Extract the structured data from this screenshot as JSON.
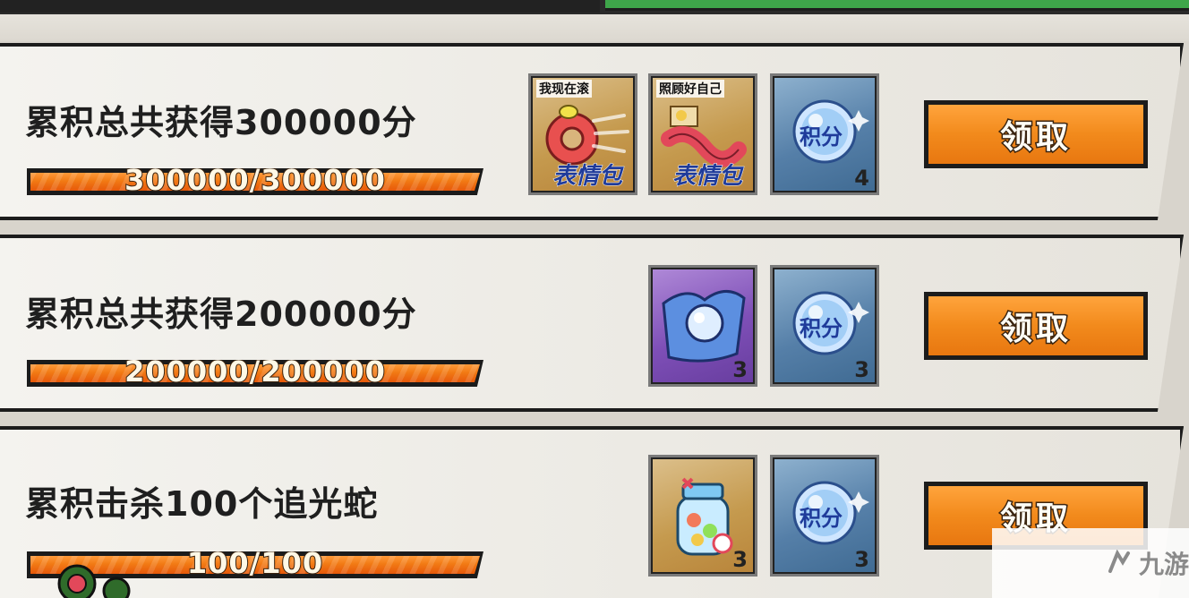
{
  "colors": {
    "accent_orange": "#f28a1c",
    "frame": "#1c1c1c",
    "header_green": "#3ea64a",
    "card_bg": "#f2f1ec"
  },
  "tasks": [
    {
      "title": "累积总共获得300000分",
      "progress_text": "300000/300000",
      "progress_fraction": 1.0,
      "rewards": [
        {
          "icon": "emoji-pack-ring-icon",
          "caption": "我现在滚",
          "stamp": "表情包",
          "count": ""
        },
        {
          "icon": "emoji-pack-worm-icon",
          "caption": "照顾好自己",
          "stamp": "表情包",
          "count": ""
        },
        {
          "icon": "points-orb-icon",
          "label": "积分",
          "count": "4"
        }
      ],
      "claim_label": "领取"
    },
    {
      "title": "累积总共获得200000分",
      "progress_text": "200000/200000",
      "progress_fraction": 1.0,
      "rewards": [
        {
          "icon": "crystal-cloth-icon",
          "count": "3"
        },
        {
          "icon": "points-orb-icon",
          "label": "积分",
          "count": "3"
        }
      ],
      "claim_label": "领取"
    },
    {
      "title": "累积击杀100个追光蛇",
      "progress_text": "100/100",
      "progress_fraction": 1.0,
      "rewards": [
        {
          "icon": "candy-jar-icon",
          "count": "3"
        },
        {
          "icon": "points-orb-icon",
          "label": "积分",
          "count": "3"
        }
      ],
      "claim_label": "领取"
    }
  ],
  "watermark": {
    "text": "九游"
  }
}
